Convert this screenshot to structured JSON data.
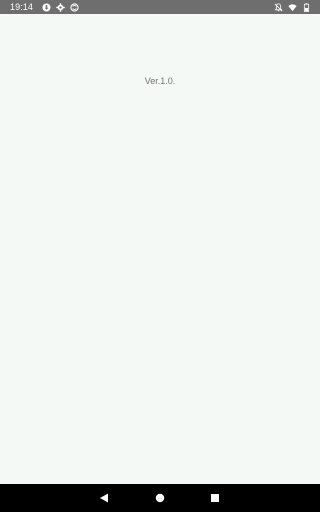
{
  "status_bar": {
    "time": "19:14",
    "left_icons": [
      "download-icon",
      "gear-icon",
      "sync-icon"
    ],
    "right_icons": [
      "notifications-off-icon",
      "wifi-icon",
      "battery-icon"
    ]
  },
  "main": {
    "version_text": "Ver.1.0."
  },
  "nav_bar": {
    "buttons": [
      "back-icon",
      "home-icon",
      "recents-icon"
    ]
  }
}
